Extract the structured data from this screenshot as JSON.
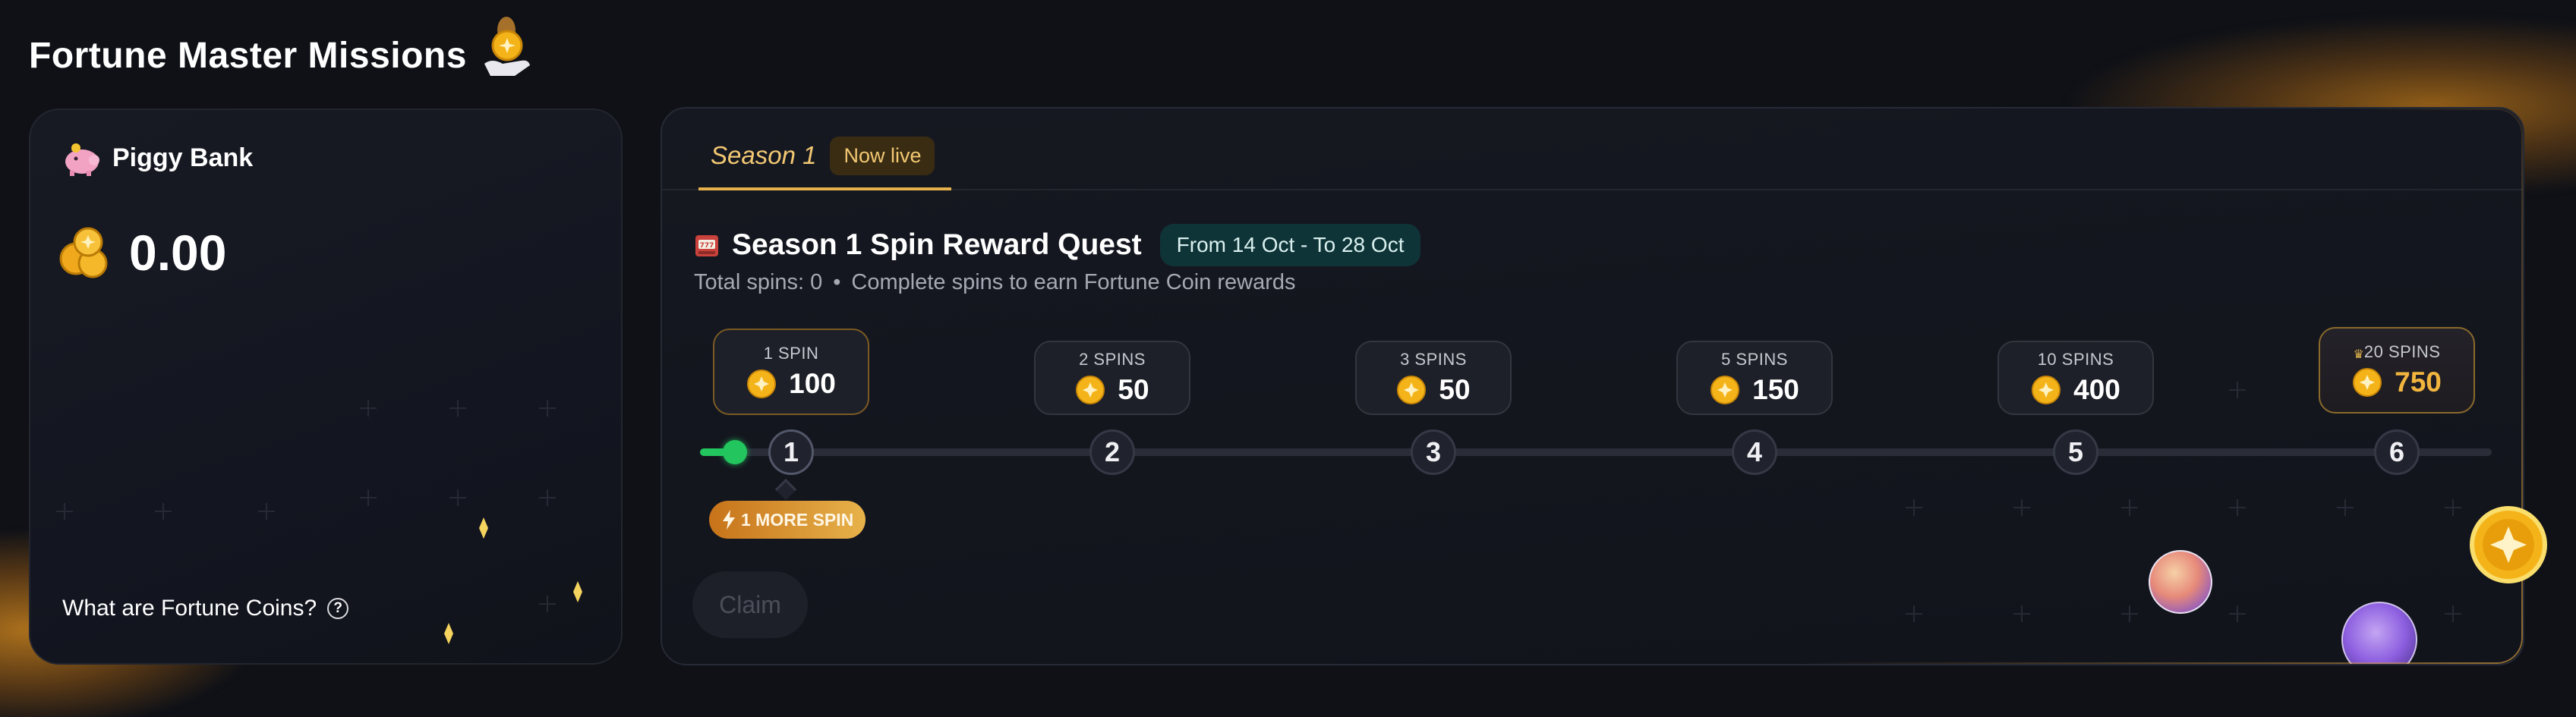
{
  "header": {
    "title": "Fortune Master Missions",
    "title_icon": "coin-trophy-icon"
  },
  "piggy_bank": {
    "label": "Piggy Bank",
    "icon": "piggy-icon",
    "balance": "0.00",
    "balance_icon": "coin-stack-icon",
    "help_link": "What are Fortune Coins?",
    "help_icon": "question-circle-icon"
  },
  "season": {
    "tab_label": "Season 1",
    "live_badge": "Now live",
    "quest_icon": "slot-machine-icon",
    "quest_title": "Season 1 Spin Reward Quest",
    "date_range": "From 14 Oct - To 28 Oct",
    "total_spins": "Total spins: 0",
    "separator": "•",
    "description": "Complete spins to earn Fortune Coin rewards",
    "progress_fraction": 0.02,
    "more_spin_badge": "1 MORE SPIN",
    "claim_label": "Claim",
    "steps": [
      {
        "step": "1",
        "spins": "1 SPIN",
        "reward": "100"
      },
      {
        "step": "2",
        "spins": "2 SPINS",
        "reward": "50"
      },
      {
        "step": "3",
        "spins": "3 SPINS",
        "reward": "50"
      },
      {
        "step": "4",
        "spins": "5 SPINS",
        "reward": "150"
      },
      {
        "step": "5",
        "spins": "10 SPINS",
        "reward": "400"
      },
      {
        "step": "6",
        "spins": "20 SPINS",
        "reward": "750"
      }
    ]
  },
  "colors": {
    "background": "#0f1117",
    "accent_gold": "#f3c873",
    "progress_green": "#22c55e",
    "date_badge_bg": "#0f3438"
  }
}
